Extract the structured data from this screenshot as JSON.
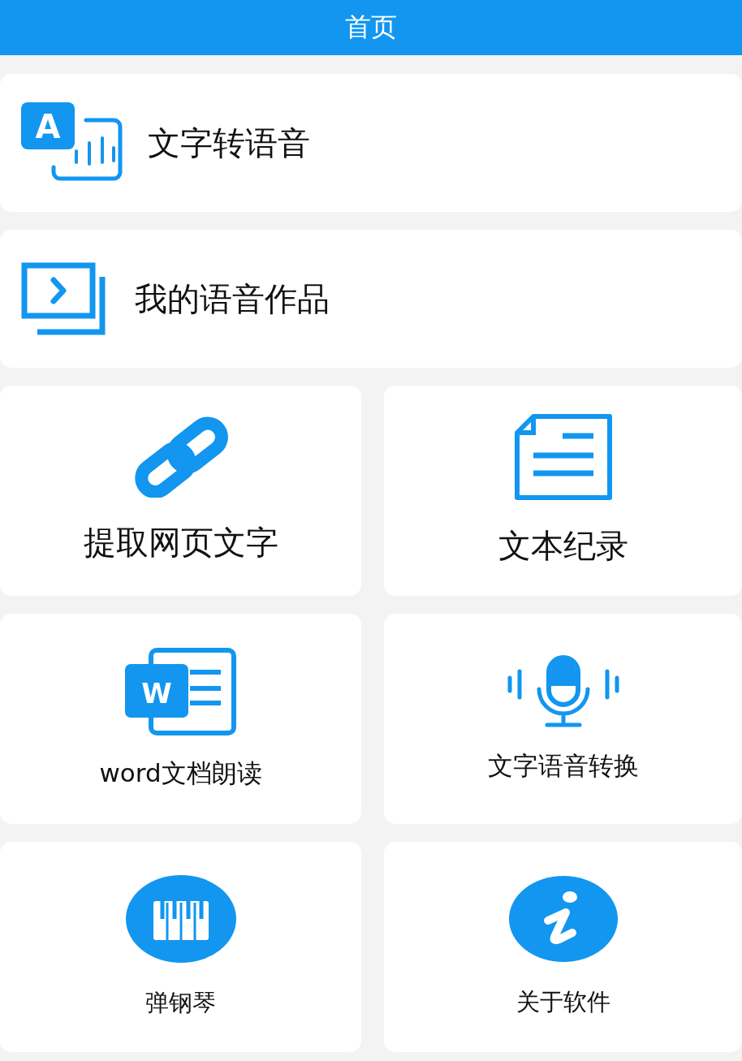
{
  "title_bar": {
    "title": "首页"
  },
  "items": [
    {
      "kind": "wide",
      "icon_text": "A",
      "label": "文字转语音"
    },
    {
      "kind": "wide",
      "label": "我的语音作品"
    },
    {
      "kind": "tile-large",
      "label": "提取网页文字"
    },
    {
      "kind": "tile-large",
      "label": "文本纪录"
    },
    {
      "kind": "tile-medium",
      "icon_text": "W",
      "label": "word文档朗读"
    },
    {
      "kind": "tile-medium",
      "label": "文字语音转换"
    },
    {
      "kind": "tile-small",
      "label": "弹钢琴"
    },
    {
      "kind": "tile-small",
      "label": "关于软件"
    }
  ]
}
